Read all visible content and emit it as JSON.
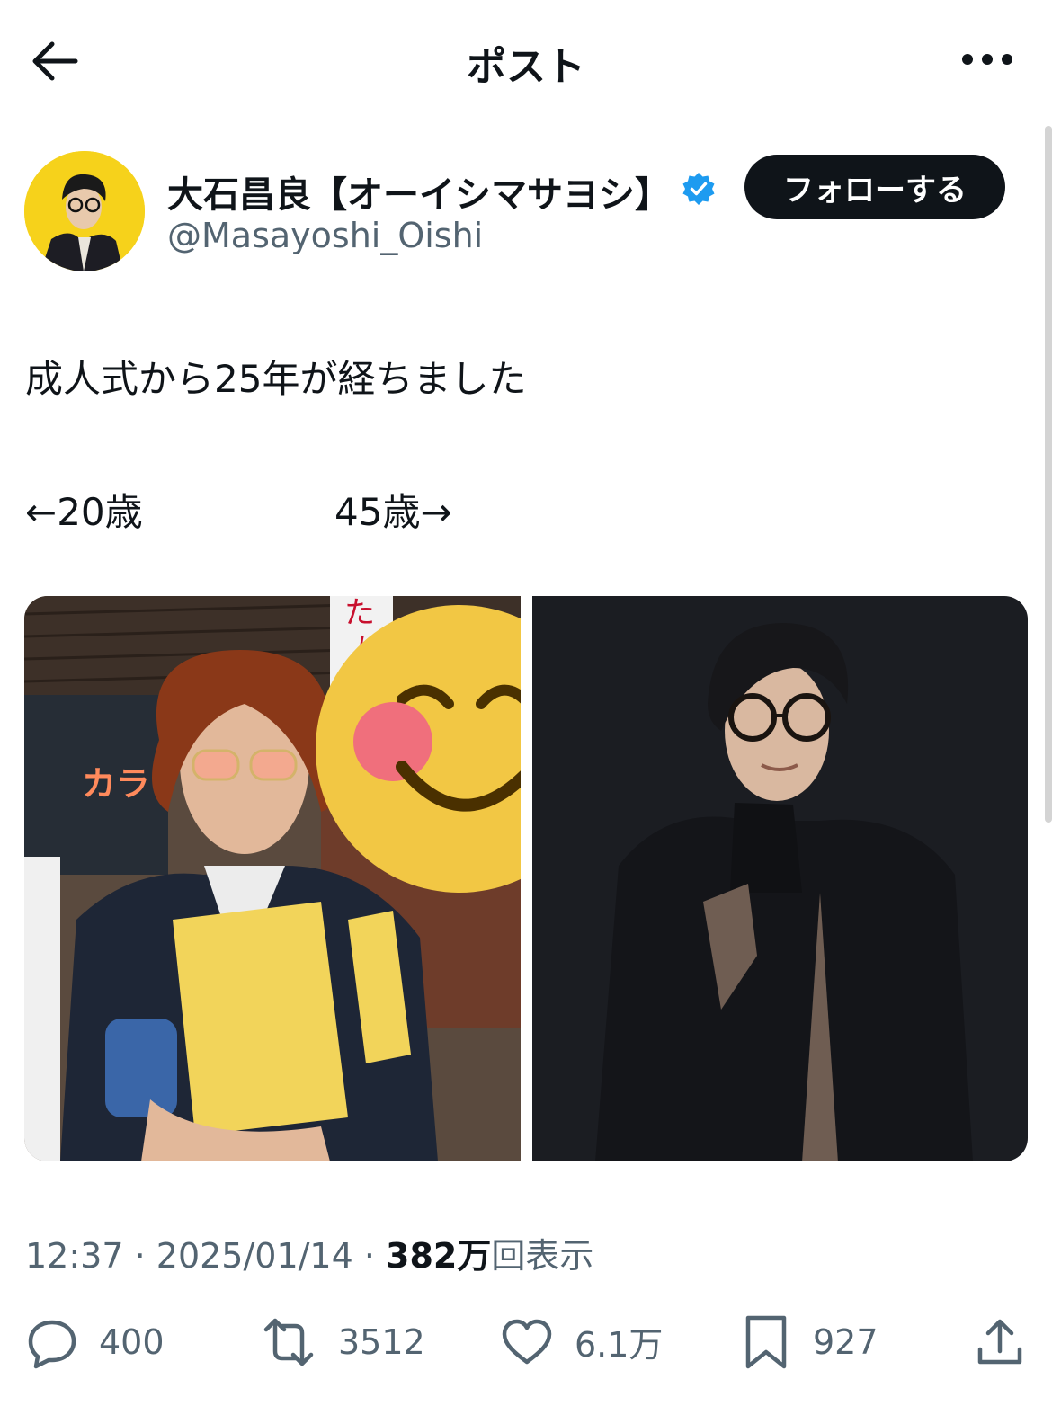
{
  "header": {
    "title": "ポスト"
  },
  "author": {
    "name": "大石昌良【オーイシマサヨシ】",
    "handle": "@Masayoshi_Oishi",
    "follow_label": "フォローする"
  },
  "post": {
    "line1": "成人式から25年が経ちました",
    "line2": "←20歳",
    "line3": "45歳→"
  },
  "meta": {
    "time": "12:37",
    "sep1": " · ",
    "date": "2025/01/14",
    "sep2": " · ",
    "views_count": "382万",
    "views_label": "回表示"
  },
  "actions": {
    "replies": "400",
    "reposts": "3512",
    "likes": "6.1万",
    "bookmarks": "927"
  },
  "colors": {
    "verified": "#1d9bf0",
    "avatar_bg": "#f6d21b"
  },
  "icons": [
    "back-arrow-icon",
    "more-icon",
    "verified-badge-icon",
    "reply-icon",
    "repost-icon",
    "like-icon",
    "bookmark-icon",
    "share-icon"
  ]
}
